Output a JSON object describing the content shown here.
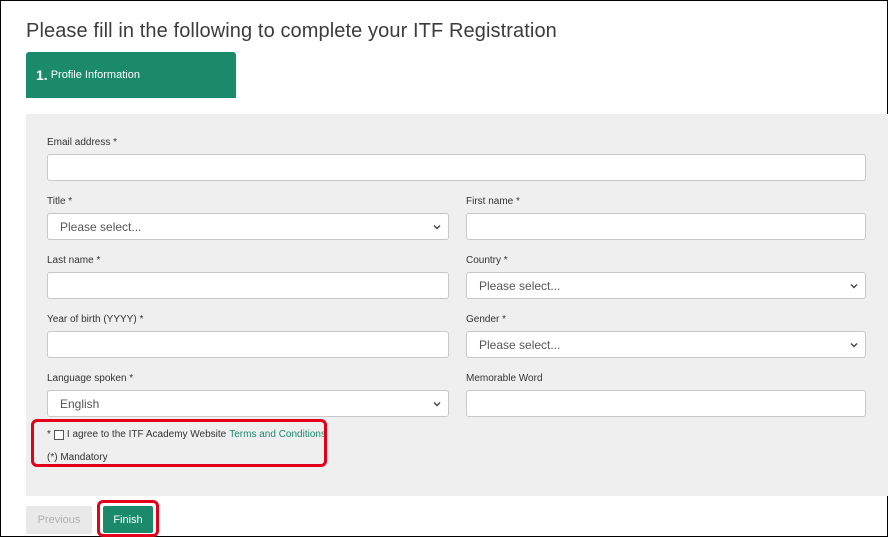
{
  "header": {
    "title": "Please fill in the following to complete your ITF Registration"
  },
  "step": {
    "number": "1.",
    "label": "Profile Information"
  },
  "form": {
    "email": {
      "label": "Email address *",
      "value": ""
    },
    "title": {
      "label": "Title *",
      "selected": "Please select..."
    },
    "first_name": {
      "label": "First name *",
      "value": ""
    },
    "last_name": {
      "label": "Last name *",
      "value": ""
    },
    "country": {
      "label": "Country *",
      "selected": "Please select..."
    },
    "year_of_birth": {
      "label": "Year of birth (YYYY) *",
      "value": ""
    },
    "gender": {
      "label": "Gender *",
      "selected": "Please select..."
    },
    "language": {
      "label": "Language spoken *",
      "selected": "English"
    },
    "memorable_word": {
      "label": "Memorable Word",
      "value": ""
    },
    "consent": {
      "prefix": "*",
      "text": "I agree to the ITF Academy Website",
      "link": "Terms and Conditions",
      "checked": false
    },
    "mandatory_note": "(*) Mandatory"
  },
  "actions": {
    "previous_label": "Previous",
    "finish_label": "Finish"
  },
  "colors": {
    "brand_green": "#1a8a6b",
    "highlight_red": "#e2001a",
    "panel_gray": "#efefef"
  }
}
